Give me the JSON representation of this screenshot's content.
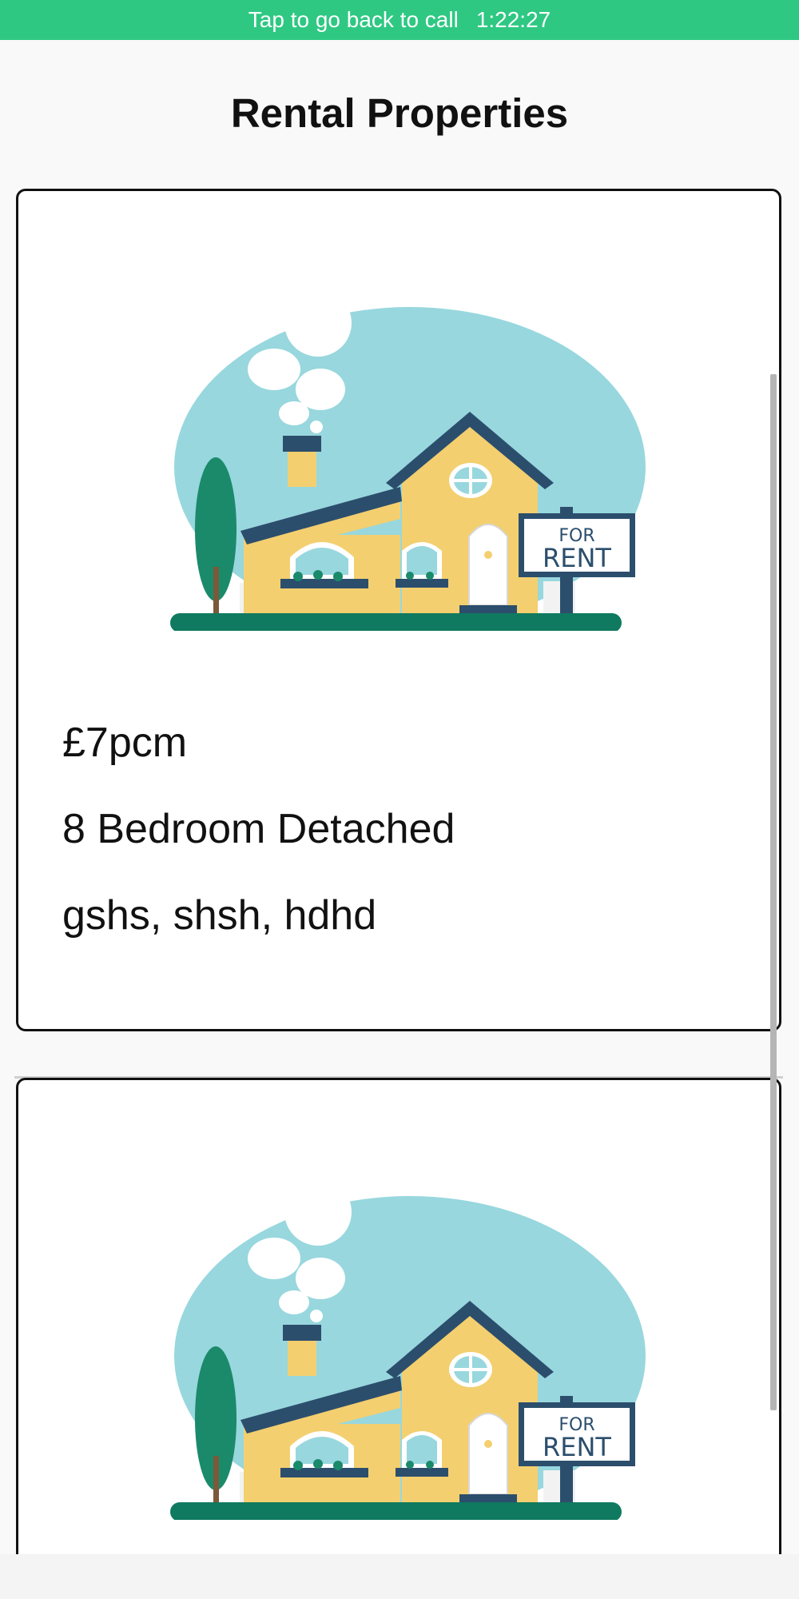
{
  "status_bar": {
    "call_text": "Tap to go back to call",
    "call_timer": "1:22:27",
    "color": "#2ec883"
  },
  "header": {
    "title": "Rental Properties"
  },
  "listings": [
    {
      "price": "£7pcm",
      "type": "8 Bedroom Detached",
      "address": "gshs, shsh, hdhd",
      "sign_line1": "FOR",
      "sign_line2": "RENT"
    },
    {
      "sign_line1": "FOR",
      "sign_line2": "RENT"
    }
  ]
}
